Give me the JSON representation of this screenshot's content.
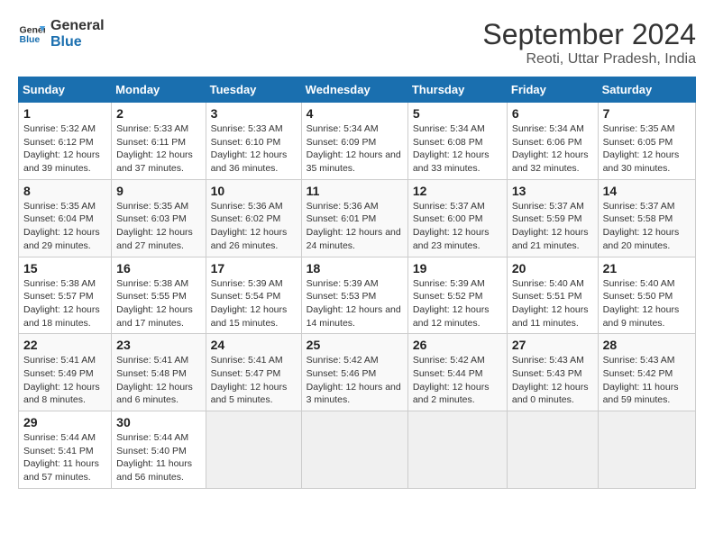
{
  "logo": {
    "line1": "General",
    "line2": "Blue"
  },
  "title": "September 2024",
  "subtitle": "Reoti, Uttar Pradesh, India",
  "days_header": [
    "Sunday",
    "Monday",
    "Tuesday",
    "Wednesday",
    "Thursday",
    "Friday",
    "Saturday"
  ],
  "weeks": [
    [
      {
        "day": "1",
        "sunrise": "Sunrise: 5:32 AM",
        "sunset": "Sunset: 6:12 PM",
        "daylight": "Daylight: 12 hours and 39 minutes."
      },
      {
        "day": "2",
        "sunrise": "Sunrise: 5:33 AM",
        "sunset": "Sunset: 6:11 PM",
        "daylight": "Daylight: 12 hours and 37 minutes."
      },
      {
        "day": "3",
        "sunrise": "Sunrise: 5:33 AM",
        "sunset": "Sunset: 6:10 PM",
        "daylight": "Daylight: 12 hours and 36 minutes."
      },
      {
        "day": "4",
        "sunrise": "Sunrise: 5:34 AM",
        "sunset": "Sunset: 6:09 PM",
        "daylight": "Daylight: 12 hours and 35 minutes."
      },
      {
        "day": "5",
        "sunrise": "Sunrise: 5:34 AM",
        "sunset": "Sunset: 6:08 PM",
        "daylight": "Daylight: 12 hours and 33 minutes."
      },
      {
        "day": "6",
        "sunrise": "Sunrise: 5:34 AM",
        "sunset": "Sunset: 6:06 PM",
        "daylight": "Daylight: 12 hours and 32 minutes."
      },
      {
        "day": "7",
        "sunrise": "Sunrise: 5:35 AM",
        "sunset": "Sunset: 6:05 PM",
        "daylight": "Daylight: 12 hours and 30 minutes."
      }
    ],
    [
      {
        "day": "8",
        "sunrise": "Sunrise: 5:35 AM",
        "sunset": "Sunset: 6:04 PM",
        "daylight": "Daylight: 12 hours and 29 minutes."
      },
      {
        "day": "9",
        "sunrise": "Sunrise: 5:35 AM",
        "sunset": "Sunset: 6:03 PM",
        "daylight": "Daylight: 12 hours and 27 minutes."
      },
      {
        "day": "10",
        "sunrise": "Sunrise: 5:36 AM",
        "sunset": "Sunset: 6:02 PM",
        "daylight": "Daylight: 12 hours and 26 minutes."
      },
      {
        "day": "11",
        "sunrise": "Sunrise: 5:36 AM",
        "sunset": "Sunset: 6:01 PM",
        "daylight": "Daylight: 12 hours and 24 minutes."
      },
      {
        "day": "12",
        "sunrise": "Sunrise: 5:37 AM",
        "sunset": "Sunset: 6:00 PM",
        "daylight": "Daylight: 12 hours and 23 minutes."
      },
      {
        "day": "13",
        "sunrise": "Sunrise: 5:37 AM",
        "sunset": "Sunset: 5:59 PM",
        "daylight": "Daylight: 12 hours and 21 minutes."
      },
      {
        "day": "14",
        "sunrise": "Sunrise: 5:37 AM",
        "sunset": "Sunset: 5:58 PM",
        "daylight": "Daylight: 12 hours and 20 minutes."
      }
    ],
    [
      {
        "day": "15",
        "sunrise": "Sunrise: 5:38 AM",
        "sunset": "Sunset: 5:57 PM",
        "daylight": "Daylight: 12 hours and 18 minutes."
      },
      {
        "day": "16",
        "sunrise": "Sunrise: 5:38 AM",
        "sunset": "Sunset: 5:55 PM",
        "daylight": "Daylight: 12 hours and 17 minutes."
      },
      {
        "day": "17",
        "sunrise": "Sunrise: 5:39 AM",
        "sunset": "Sunset: 5:54 PM",
        "daylight": "Daylight: 12 hours and 15 minutes."
      },
      {
        "day": "18",
        "sunrise": "Sunrise: 5:39 AM",
        "sunset": "Sunset: 5:53 PM",
        "daylight": "Daylight: 12 hours and 14 minutes."
      },
      {
        "day": "19",
        "sunrise": "Sunrise: 5:39 AM",
        "sunset": "Sunset: 5:52 PM",
        "daylight": "Daylight: 12 hours and 12 minutes."
      },
      {
        "day": "20",
        "sunrise": "Sunrise: 5:40 AM",
        "sunset": "Sunset: 5:51 PM",
        "daylight": "Daylight: 12 hours and 11 minutes."
      },
      {
        "day": "21",
        "sunrise": "Sunrise: 5:40 AM",
        "sunset": "Sunset: 5:50 PM",
        "daylight": "Daylight: 12 hours and 9 minutes."
      }
    ],
    [
      {
        "day": "22",
        "sunrise": "Sunrise: 5:41 AM",
        "sunset": "Sunset: 5:49 PM",
        "daylight": "Daylight: 12 hours and 8 minutes."
      },
      {
        "day": "23",
        "sunrise": "Sunrise: 5:41 AM",
        "sunset": "Sunset: 5:48 PM",
        "daylight": "Daylight: 12 hours and 6 minutes."
      },
      {
        "day": "24",
        "sunrise": "Sunrise: 5:41 AM",
        "sunset": "Sunset: 5:47 PM",
        "daylight": "Daylight: 12 hours and 5 minutes."
      },
      {
        "day": "25",
        "sunrise": "Sunrise: 5:42 AM",
        "sunset": "Sunset: 5:46 PM",
        "daylight": "Daylight: 12 hours and 3 minutes."
      },
      {
        "day": "26",
        "sunrise": "Sunrise: 5:42 AM",
        "sunset": "Sunset: 5:44 PM",
        "daylight": "Daylight: 12 hours and 2 minutes."
      },
      {
        "day": "27",
        "sunrise": "Sunrise: 5:43 AM",
        "sunset": "Sunset: 5:43 PM",
        "daylight": "Daylight: 12 hours and 0 minutes."
      },
      {
        "day": "28",
        "sunrise": "Sunrise: 5:43 AM",
        "sunset": "Sunset: 5:42 PM",
        "daylight": "Daylight: 11 hours and 59 minutes."
      }
    ],
    [
      {
        "day": "29",
        "sunrise": "Sunrise: 5:44 AM",
        "sunset": "Sunset: 5:41 PM",
        "daylight": "Daylight: 11 hours and 57 minutes."
      },
      {
        "day": "30",
        "sunrise": "Sunrise: 5:44 AM",
        "sunset": "Sunset: 5:40 PM",
        "daylight": "Daylight: 11 hours and 56 minutes."
      },
      null,
      null,
      null,
      null,
      null
    ]
  ]
}
